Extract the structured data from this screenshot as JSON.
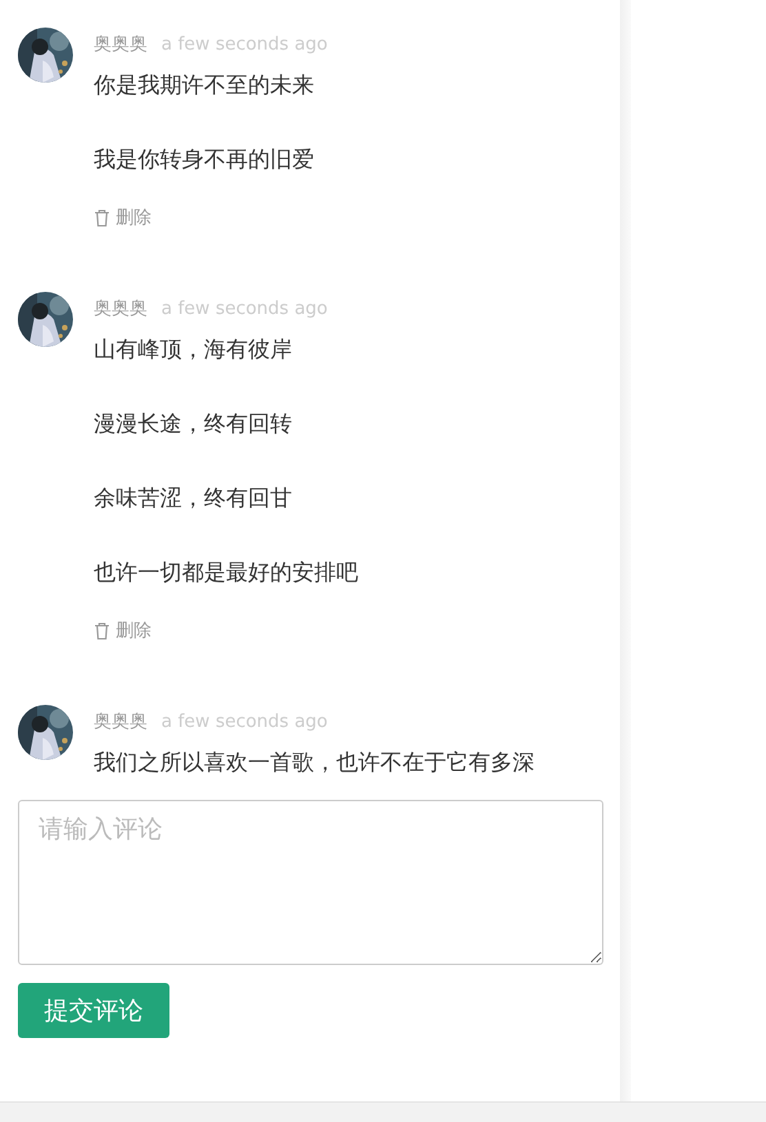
{
  "comments": [
    {
      "author": "奥奥奥",
      "time": "a few seconds ago",
      "lines": [
        "你是我期许不至的未来",
        "我是你转身不再的旧爱"
      ],
      "delete_label": "删除"
    },
    {
      "author": "奥奥奥",
      "time": "a few seconds ago",
      "lines": [
        "山有峰顶，海有彼岸",
        "漫漫长途，终有回转",
        "余味苦涩，终有回甘",
        "也许一切都是最好的安排吧"
      ],
      "delete_label": "删除"
    },
    {
      "author": "奥奥奥",
      "time": "a few seconds ago",
      "lines": [
        "我们之所以喜欢一首歌，也许不在于它有多深"
      ]
    }
  ],
  "comment_input": {
    "placeholder": "请输入评论"
  },
  "submit_button": "提交评论"
}
